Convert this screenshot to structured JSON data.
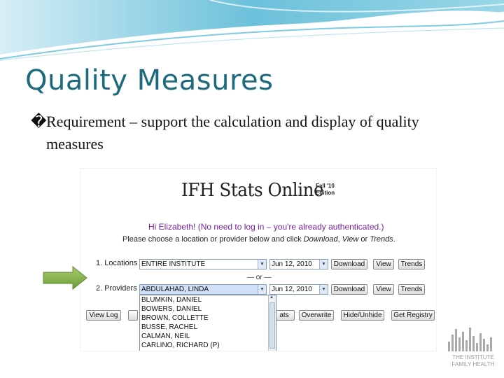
{
  "slide": {
    "title": "Quality Measures",
    "bullet_marker": "�",
    "bullet_text": "Requirement – support the calculation and display of quality measures"
  },
  "app": {
    "title": "IFH Stats Online",
    "edition_line1": "Fall '10",
    "edition_line2": "Edition",
    "greeting": "Hi Elizabeth! (No need to log in – you're already authenticated.)",
    "instructions_prefix": "Please choose a location or provider below and click ",
    "instructions_download": "Download",
    "instructions_sep1": ", ",
    "instructions_view": "View",
    "instructions_sep2": " or ",
    "instructions_trends": "Trends",
    "instructions_suffix": ".",
    "locations_label": "1. Locations",
    "locations_value": "ENTIRE INSTITUTE",
    "locations_date": "Jun 12, 2010",
    "or_label": "— or —",
    "providers_label": "2. Providers",
    "providers_value": "ABDULAHAD, LINDA",
    "providers_date": "Jun 12, 2010",
    "download_label": "Download",
    "view_label": "View",
    "trends_label": "Trends",
    "view_log_label": "View Log",
    "stats_label": "ats",
    "overwrite_label": "Overwrite",
    "hide_unhide_label": "Hide/Unhide",
    "get_registry_label": "Get Registry",
    "provider_options": [
      "BLUMKIN, DANIEL",
      "BOWERS, DANIEL",
      "BROWN, COLLETTE",
      "BUSSE, RACHEL",
      "CALMAN, NEIL",
      "CARLINO, RICHARD (P)"
    ]
  },
  "logo": {
    "line1": "THE INSTITUTE",
    "line2": "FAMILY HEALTH"
  },
  "colors": {
    "title": "#1c6a7d",
    "wave": "#5fb7d3",
    "greeting": "#7b1fa2",
    "arrow": "#7fae45"
  }
}
